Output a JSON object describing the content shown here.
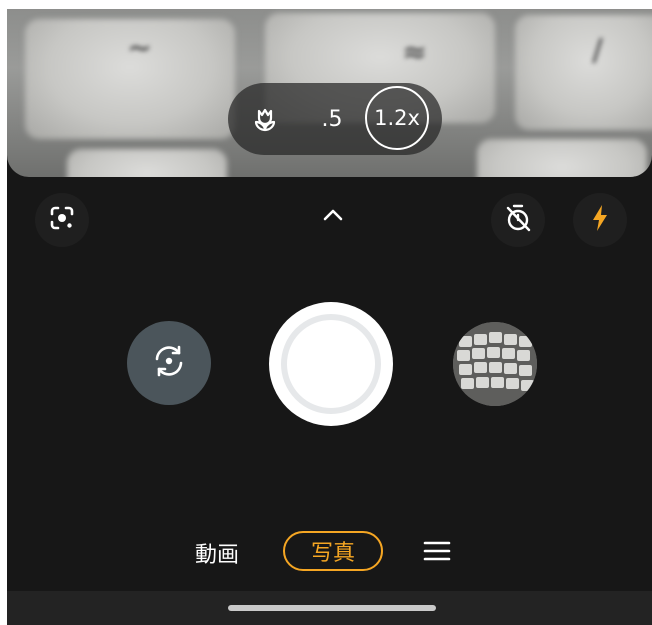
{
  "viewfinder": {
    "zoom": {
      "macro_icon": "flower-macro-icon",
      "wide_label": ".5",
      "current_label": "1.2x"
    }
  },
  "controls": {
    "lens_icon": "google-lens-icon",
    "expand_icon": "chevron-up-icon",
    "timer_icon": "timer-off-icon",
    "flash_icon": "flash-bolt-icon"
  },
  "capture": {
    "switch_icon": "switch-camera-icon",
    "shutter_icon": "shutter-icon",
    "thumbnail_icon": "gallery-thumbnail"
  },
  "modes": {
    "video_label": "動画",
    "photo_label": "写真",
    "more_icon": "menu-icon"
  },
  "colors": {
    "accent": "#f5a623",
    "background": "#171717",
    "switch_button": "#4b555b"
  }
}
